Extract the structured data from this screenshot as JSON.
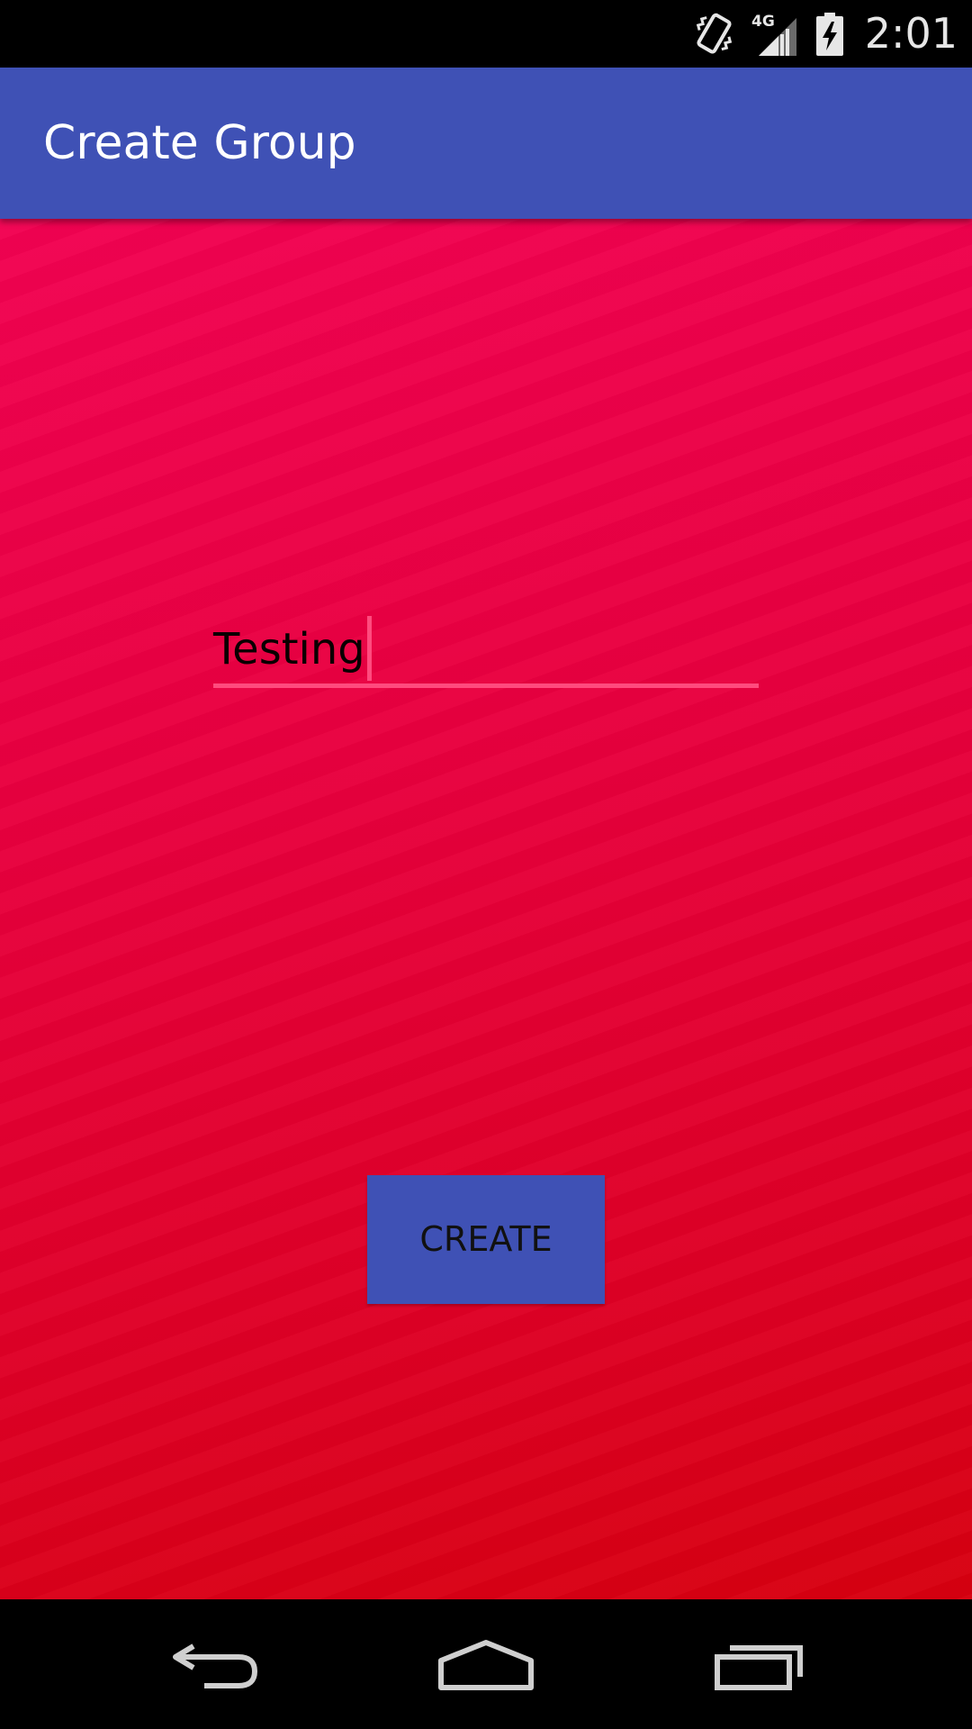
{
  "status_bar": {
    "time": "2:01",
    "network_label": "4G",
    "icons": [
      "vibrate-icon",
      "signal-4g-icon",
      "battery-charging-icon"
    ]
  },
  "app_bar": {
    "title": "Create Group"
  },
  "form": {
    "group_name_value": "Testing",
    "create_button_label": "CREATE"
  },
  "nav_bar": {
    "buttons": [
      "back-icon",
      "home-icon",
      "recents-icon"
    ]
  },
  "colors": {
    "primary": "#3f51b5",
    "background_top": "#f20252",
    "background_bottom": "#d7000f",
    "accent": "#ff4b7e"
  }
}
